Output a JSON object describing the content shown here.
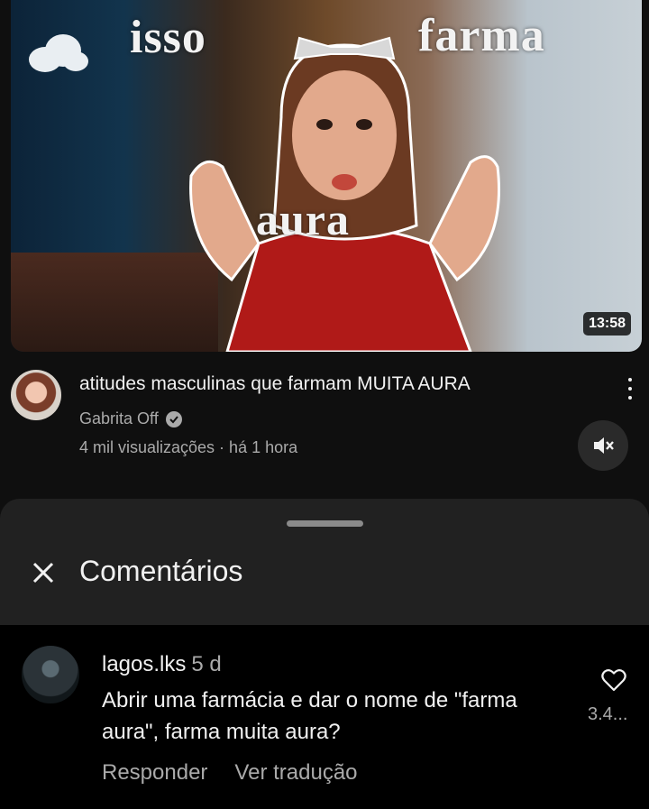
{
  "video": {
    "thumbnail_words": [
      "isso",
      "farma",
      "aura"
    ],
    "duration": "13:58",
    "title": "atitudes masculinas que farmam MUITA AURA",
    "channel": "Gabrita Off",
    "meta": "4 mil visualizações · há 1 hora"
  },
  "comments_sheet": {
    "title": "Comentários",
    "comments": [
      {
        "user": "lagos.lks",
        "age": "5 d",
        "text": "Abrir uma farmácia e dar o nome de \"farma aura\", farma muita aura?",
        "like_count": "3.4...",
        "reply_label": "Responder",
        "translate_label": "Ver tradução"
      }
    ]
  },
  "colors": {
    "background": "#0f0f0f",
    "sheet": "#212121",
    "secondary_text": "#aaaaaa"
  },
  "icons": [
    "cloud-icon",
    "verified-icon",
    "more-vert-icon",
    "mute-icon",
    "close-icon",
    "heart-icon"
  ]
}
